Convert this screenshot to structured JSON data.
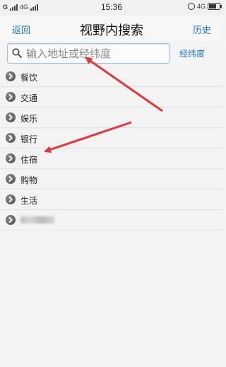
{
  "status_bar": {
    "left_network_1": "4G",
    "time": "15:36",
    "right_network": "4G"
  },
  "nav": {
    "back_label": "返回",
    "title": "视野内搜索",
    "history_label": "历史"
  },
  "search": {
    "placeholder": "输入地址或经纬度",
    "value": "",
    "latlng_label": "经纬度"
  },
  "categories": [
    {
      "label": "餐饮"
    },
    {
      "label": "交通"
    },
    {
      "label": "娱乐"
    },
    {
      "label": "银行"
    },
    {
      "label": "住宿"
    },
    {
      "label": "购物"
    },
    {
      "label": "生活"
    },
    {
      "label": ""
    }
  ],
  "colors": {
    "link": "#1e73c8",
    "annotation_arrow": "#e8333a"
  },
  "icons": {
    "search": "search-icon",
    "category": "chevron-right-circle-icon"
  }
}
